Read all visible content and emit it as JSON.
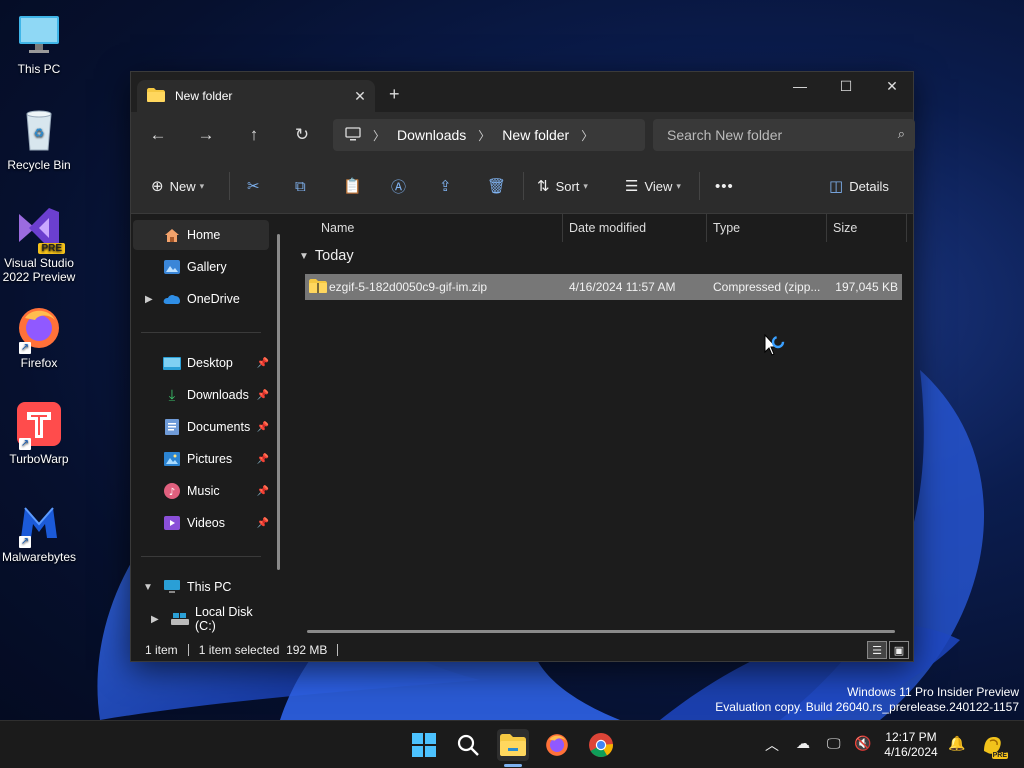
{
  "desktop": {
    "icons": [
      {
        "label": "This PC",
        "icon": "monitor-icon"
      },
      {
        "label": "Recycle Bin",
        "icon": "recycle-bin-icon"
      },
      {
        "label": "Visual Studio\n2022 Preview",
        "line1": "Visual Studio",
        "line2": "2022 Preview",
        "badge": "PRE",
        "icon": "visual-studio-icon"
      },
      {
        "label": "Firefox",
        "icon": "firefox-icon"
      },
      {
        "label": "TurboWarp",
        "icon": "turbowarp-icon"
      },
      {
        "label": "Malwarebytes",
        "icon": "malwarebytes-icon"
      }
    ]
  },
  "window": {
    "tab_title": "New folder",
    "controls": {
      "minimize": "—",
      "maximize": "☐",
      "close": "✕"
    },
    "address": {
      "crumbs": [
        "Downloads",
        "New folder"
      ],
      "search_placeholder": "Search New folder"
    },
    "toolbar": {
      "new_label": "New",
      "sort_label": "Sort",
      "view_label": "View",
      "more_label": "•••",
      "details_label": "Details"
    },
    "nav": {
      "home": "Home",
      "gallery": "Gallery",
      "onedrive": "OneDrive",
      "desktop": "Desktop",
      "downloads": "Downloads",
      "documents": "Documents",
      "pictures": "Pictures",
      "music": "Music",
      "videos": "Videos",
      "this_pc": "This PC",
      "local_disk": "Local Disk (C:)"
    },
    "columns": {
      "name": "Name",
      "date": "Date modified",
      "type": "Type",
      "size": "Size"
    },
    "group_label": "Today",
    "files": [
      {
        "name": "ezgif-5-182d0050c9-gif-im.zip",
        "date": "4/16/2024 11:57 AM",
        "type": "Compressed (zipp...",
        "size": "197,045 KB"
      }
    ],
    "status": {
      "count": "1 item",
      "selection": "1 item selected  192 MB"
    }
  },
  "watermark": {
    "line1": "Windows 11 Pro Insider Preview",
    "line2": "Evaluation copy. Build 26040.rs_prerelease.240122-1157"
  },
  "taskbar": {
    "time": "12:17 PM",
    "date": "4/16/2024",
    "tray_badge": "PRE"
  },
  "colors": {
    "accent": "#7fb2f0",
    "selection": "#777777",
    "window_bg": "#1c1c1c"
  }
}
